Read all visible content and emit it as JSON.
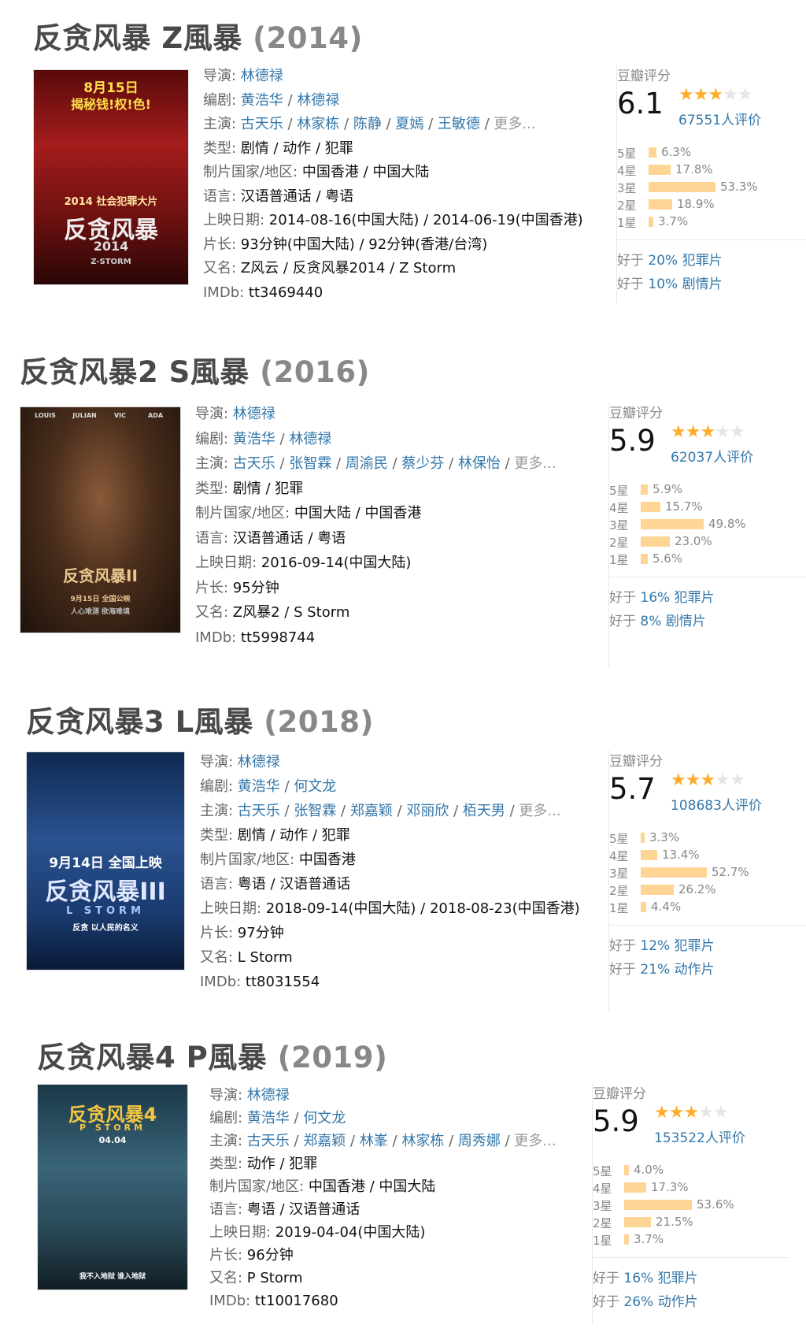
{
  "labels": {
    "director": "导演: ",
    "writer": "编剧: ",
    "cast": "主演: ",
    "genre": "类型: ",
    "region": "制片国家/地区: ",
    "language": "语言: ",
    "release": "上映日期: ",
    "runtime": "片长: ",
    "aka": "又名: ",
    "imdb": "IMDb: ",
    "douban_rating": "豆瓣评分",
    "better_prefix": "好于 ",
    "more": "更多..."
  },
  "movies": [
    {
      "title": "反贪风暴 Z風暴",
      "year": "(2014)",
      "poster_text": [
        "8月15日",
        "揭秘钱!权!色!",
        "2014 社会犯罪大片",
        "反贪风暴",
        "2014",
        "Z-STORM"
      ],
      "director": [
        "林德禄"
      ],
      "writer": [
        "黄浩华",
        "林德禄"
      ],
      "cast": [
        "古天乐",
        "林家栋",
        "陈静",
        "夏嫣",
        "王敏德"
      ],
      "genre": "剧情 / 动作 / 犯罪",
      "region": "中国香港 / 中国大陆",
      "language": "汉语普通话 / 粤语",
      "release": "2014-08-16(中国大陆) / 2014-06-19(中国香港)",
      "runtime": "93分钟(中国大陆) / 92分钟(香港/台湾)",
      "aka": "Z风云 / 反贪风暴2014 / Z Storm",
      "imdb": "tt3469440",
      "score": "6.1",
      "stars": 3,
      "votes": "67551人评价",
      "dist": [
        {
          "label": "5星",
          "pct": "6.3%",
          "value": 6.3
        },
        {
          "label": "4星",
          "pct": "17.8%",
          "value": 17.8
        },
        {
          "label": "3星",
          "pct": "53.3%",
          "value": 53.3
        },
        {
          "label": "2星",
          "pct": "18.9%",
          "value": 18.9
        },
        {
          "label": "1星",
          "pct": "3.7%",
          "value": 3.7
        }
      ],
      "better": [
        {
          "pct": "20%",
          "genre": "犯罪片"
        },
        {
          "pct": "10%",
          "genre": "剧情片"
        }
      ]
    },
    {
      "title": "反贪风暴2 S風暴",
      "year": "(2016)",
      "poster_text": [
        "LOUIS",
        "JULIAN",
        "VIC",
        "ADA",
        "反贪风暴II",
        "9月15日 全国公映",
        "人心难测  欲海难填"
      ],
      "director": [
        "林德禄"
      ],
      "writer": [
        "黄浩华",
        "林德禄"
      ],
      "cast": [
        "古天乐",
        "张智霖",
        "周渝民",
        "蔡少芬",
        "林保怡"
      ],
      "genre": "剧情 / 犯罪",
      "region": "中国大陆 / 中国香港",
      "language": "汉语普通话 / 粤语",
      "release": "2016-09-14(中国大陆)",
      "runtime": "95分钟",
      "aka": "Z风暴2 / S Storm",
      "imdb": "tt5998744",
      "score": "5.9",
      "stars": 3,
      "votes": "62037人评价",
      "dist": [
        {
          "label": "5星",
          "pct": "5.9%",
          "value": 5.9
        },
        {
          "label": "4星",
          "pct": "15.7%",
          "value": 15.7
        },
        {
          "label": "3星",
          "pct": "49.8%",
          "value": 49.8
        },
        {
          "label": "2星",
          "pct": "23.0%",
          "value": 23.0
        },
        {
          "label": "1星",
          "pct": "5.6%",
          "value": 5.6
        }
      ],
      "better": [
        {
          "pct": "16%",
          "genre": "犯罪片"
        },
        {
          "pct": "8%",
          "genre": "剧情片"
        }
      ]
    },
    {
      "title": "反贪风暴3 L風暴",
      "year": "(2018)",
      "poster_text": [
        "9月14日 全国上映",
        "反贪风暴III",
        "L STORM",
        "反贪 以人民的名义"
      ],
      "director": [
        "林德禄"
      ],
      "writer": [
        "黄浩华",
        "何文龙"
      ],
      "cast": [
        "古天乐",
        "张智霖",
        "郑嘉颖",
        "邓丽欣",
        "栢天男"
      ],
      "genre": "剧情 / 动作 / 犯罪",
      "region": "中国香港",
      "language": "粤语 / 汉语普通话",
      "release": "2018-09-14(中国大陆) / 2018-08-23(中国香港)",
      "runtime": "97分钟",
      "aka": "L Storm",
      "imdb": "tt8031554",
      "score": "5.7",
      "stars": 3,
      "votes": "108683人评价",
      "dist": [
        {
          "label": "5星",
          "pct": "3.3%",
          "value": 3.3
        },
        {
          "label": "4星",
          "pct": "13.4%",
          "value": 13.4
        },
        {
          "label": "3星",
          "pct": "52.7%",
          "value": 52.7
        },
        {
          "label": "2星",
          "pct": "26.2%",
          "value": 26.2
        },
        {
          "label": "1星",
          "pct": "4.4%",
          "value": 4.4
        }
      ],
      "better": [
        {
          "pct": "12%",
          "genre": "犯罪片"
        },
        {
          "pct": "21%",
          "genre": "动作片"
        }
      ]
    },
    {
      "title": "反贪风暴4 P風暴",
      "year": "(2019)",
      "poster_text": [
        "反贪风暴4",
        "P STORM",
        "04.04",
        "我不入地狱 谁入地狱"
      ],
      "director": [
        "林德禄"
      ],
      "writer": [
        "黄浩华",
        "何文龙"
      ],
      "cast": [
        "古天乐",
        "郑嘉颖",
        "林峯",
        "林家栋",
        "周秀娜"
      ],
      "genre": "动作 / 犯罪",
      "region": "中国香港 / 中国大陆",
      "language": "粤语 / 汉语普通话",
      "release": "2019-04-04(中国大陆)",
      "runtime": "96分钟",
      "aka": "P Storm",
      "imdb": "tt10017680",
      "score": "5.9",
      "stars": 3,
      "votes": "153522人评价",
      "dist": [
        {
          "label": "5星",
          "pct": "4.0%",
          "value": 4.0
        },
        {
          "label": "4星",
          "pct": "17.3%",
          "value": 17.3
        },
        {
          "label": "3星",
          "pct": "53.6%",
          "value": 53.6
        },
        {
          "label": "2星",
          "pct": "21.5%",
          "value": 21.5
        },
        {
          "label": "1星",
          "pct": "3.7%",
          "value": 3.7
        }
      ],
      "better": [
        {
          "pct": "16%",
          "genre": "犯罪片"
        },
        {
          "pct": "26%",
          "genre": "动作片"
        }
      ]
    }
  ],
  "colors": {
    "link": "#3377aa",
    "bar": "#ffd596",
    "star": "#ffac2d",
    "poster1": "#8a1414",
    "poster2": "#2a1a10",
    "poster3": "#1d3b6a",
    "poster4": "#2d4a5a"
  }
}
